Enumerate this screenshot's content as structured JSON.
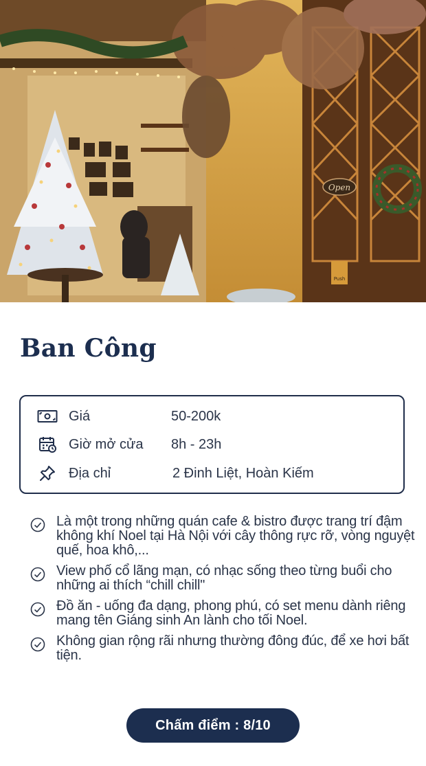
{
  "place": {
    "name": "Ban Công"
  },
  "info": {
    "rows": [
      {
        "icon": "money-icon",
        "label": "Giá",
        "value": "50-200k"
      },
      {
        "icon": "calendar-clock-icon",
        "label": "Giờ mở cửa",
        "value": "8h - 23h"
      },
      {
        "icon": "pin-icon",
        "label": "Địa chỉ",
        "value": "2 Đinh Liệt, Hoàn Kiếm"
      }
    ]
  },
  "highlights": [
    "Là một trong những quán cafe & bistro được trang trí đậm không khí Noel tại Hà Nội với cây thông rực rỡ, vòng nguyệt quế, hoa khô,...",
    "View phố cổ lãng mạn, có nhạc sống theo từng buổi cho những ai thích “chill chill\"",
    "Đồ ăn - uống đa dạng, phong phú, có set menu dành riêng mang tên Giáng sinh An lành cho tối Noel.",
    "Không gian rộng rãi nhưng thường đông đúc, để xe hơi bất tiện."
  ],
  "photo": {
    "sign_text": "Open",
    "door_sign_text": "Push"
  },
  "score": {
    "label": "Chấm điểm : 8/10"
  },
  "colors": {
    "navy": "#1c2e4f",
    "text": "#2a3448",
    "wall": "#d8a84a",
    "wood": "#5a3418"
  }
}
